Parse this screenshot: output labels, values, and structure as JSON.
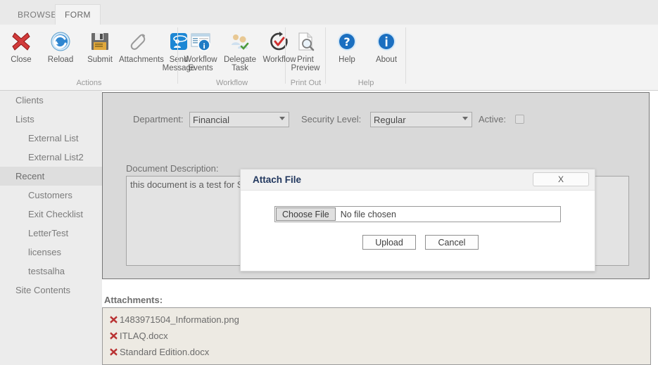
{
  "tabs": [
    {
      "label": "BROWSE",
      "active": false
    },
    {
      "label": "FORM",
      "active": true
    }
  ],
  "ribbon": {
    "groups": [
      {
        "name": "Actions",
        "label": "Actions",
        "items": [
          {
            "label": "Close",
            "icon": "red-x-icon"
          },
          {
            "label": "Reload",
            "icon": "blue-refresh-icon"
          },
          {
            "label": "Submit",
            "icon": "floppy-disk-save-icon"
          },
          {
            "label": "Attachments",
            "icon": "paperclip-icon"
          },
          {
            "label": "Send\nMessage",
            "icon": "send-message-icon"
          }
        ]
      },
      {
        "name": "Workflow",
        "label": "Workflow",
        "items": [
          {
            "label": "Workflow\nEvents",
            "icon": "workflow-events-icon"
          },
          {
            "label": "Delegate\nTask",
            "icon": "delegate-task-icon"
          },
          {
            "label": "Workflow",
            "icon": "workflow-check-icon"
          }
        ]
      },
      {
        "name": "Print Out",
        "label": "Print Out",
        "items": [
          {
            "label": "Print\nPreview",
            "icon": "print-preview-icon"
          }
        ]
      },
      {
        "name": "Help",
        "label": "Help",
        "items": [
          {
            "label": "Help",
            "icon": "question-mark-icon"
          },
          {
            "label": "About",
            "icon": "info-icon"
          }
        ]
      }
    ]
  },
  "sidebar": {
    "items": [
      {
        "label": "Clients",
        "sub": false,
        "selected": false
      },
      {
        "label": "Lists",
        "sub": false,
        "selected": false
      },
      {
        "label": "External List",
        "sub": true,
        "selected": false
      },
      {
        "label": "External List2",
        "sub": true,
        "selected": false
      },
      {
        "label": "Recent",
        "sub": false,
        "selected": true
      },
      {
        "label": "Customers",
        "sub": true,
        "selected": false
      },
      {
        "label": "Exit Checklist",
        "sub": true,
        "selected": false
      },
      {
        "label": "LetterTest",
        "sub": true,
        "selected": false
      },
      {
        "label": "licenses",
        "sub": true,
        "selected": false
      },
      {
        "label": "testsalha",
        "sub": true,
        "selected": false
      },
      {
        "label": "Site Contents",
        "sub": false,
        "selected": false
      }
    ]
  },
  "form": {
    "department": {
      "label": "Department:",
      "value": "Financial",
      "options": [
        "Financial"
      ]
    },
    "security_level": {
      "label": "Security Level:",
      "value": "Regular",
      "options": [
        "Regular"
      ]
    },
    "active": {
      "label": "Active:",
      "checked": false
    },
    "description": {
      "label": "Document Description:",
      "value": "this document is a test for S"
    }
  },
  "attachments": {
    "label": "Attachments:",
    "items": [
      {
        "name": "1483971504_Information.png",
        "remove_icon": "red-x-icon"
      },
      {
        "name": "ITLAQ.docx",
        "remove_icon": "red-x-icon"
      },
      {
        "name": "Standard Edition.docx",
        "remove_icon": "red-x-icon"
      }
    ]
  },
  "dialog": {
    "title": "Attach File",
    "close_label": "X",
    "choose_file_label": "Choose File",
    "file_status": "No file chosen",
    "upload_label": "Upload",
    "cancel_label": "Cancel"
  },
  "colors": {
    "accent_red": "#c62828",
    "accent_blue": "#1a6fc4",
    "dialog_title": "#21375e",
    "ribbon_bg": "#f3f3f3",
    "panel_bg": "#d9d9d9",
    "attach_bg": "#edeae3"
  }
}
